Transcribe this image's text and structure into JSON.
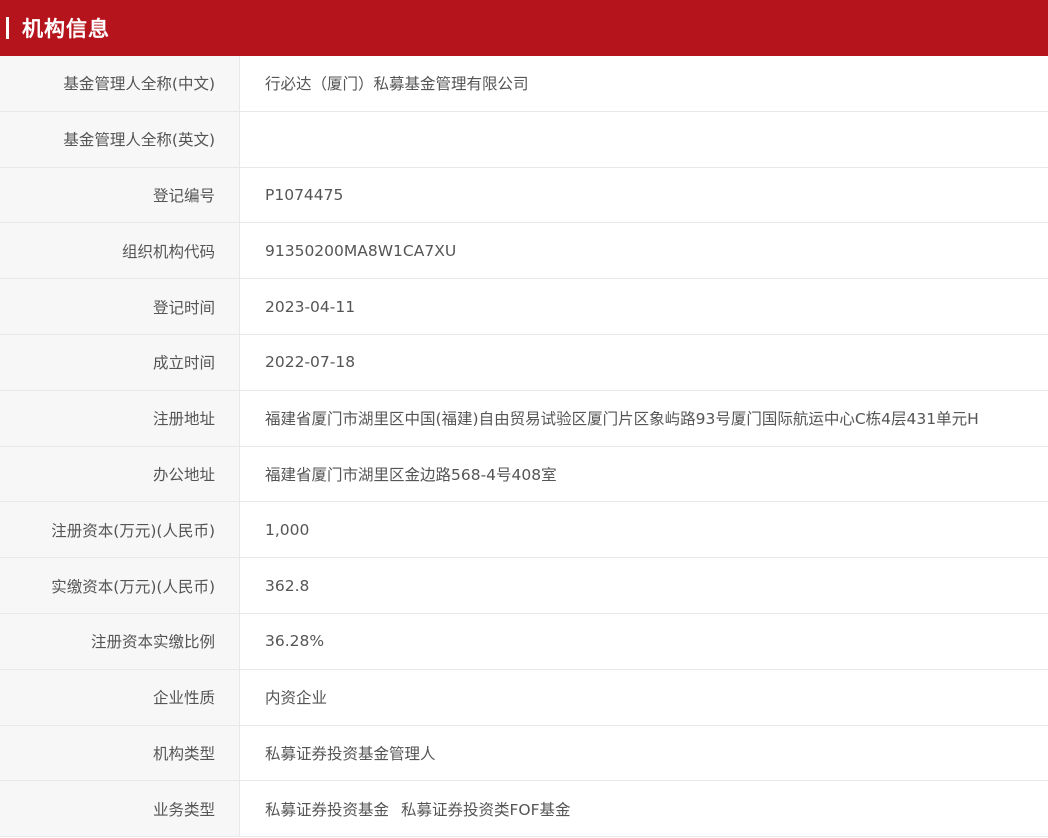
{
  "section": {
    "title": "机构信息"
  },
  "rows": [
    {
      "label": "基金管理人全称(中文)",
      "value": "行必达（厦门）私募基金管理有限公司"
    },
    {
      "label": "基金管理人全称(英文)",
      "value": ""
    },
    {
      "label": "登记编号",
      "value": "P1074475"
    },
    {
      "label": "组织机构代码",
      "value": "91350200MA8W1CA7XU"
    },
    {
      "label": "登记时间",
      "value": "2023-04-11"
    },
    {
      "label": "成立时间",
      "value": "2022-07-18"
    },
    {
      "label": "注册地址",
      "value": "福建省厦门市湖里区中国(福建)自由贸易试验区厦门片区象屿路93号厦门国际航运中心C栋4层431单元H"
    },
    {
      "label": "办公地址",
      "value": "福建省厦门市湖里区金边路568-4号408室"
    },
    {
      "label": "注册资本(万元)(人民币)",
      "value": "1,000"
    },
    {
      "label": "实缴资本(万元)(人民币)",
      "value": "362.8"
    },
    {
      "label": "注册资本实缴比例",
      "value": "36.28%"
    },
    {
      "label": "企业性质",
      "value": "内资企业"
    },
    {
      "label": "机构类型",
      "value": "私募证券投资基金管理人"
    },
    {
      "label": "业务类型",
      "values": [
        "私募证券投资基金",
        "私募证券投资类FOF基金"
      ]
    }
  ]
}
